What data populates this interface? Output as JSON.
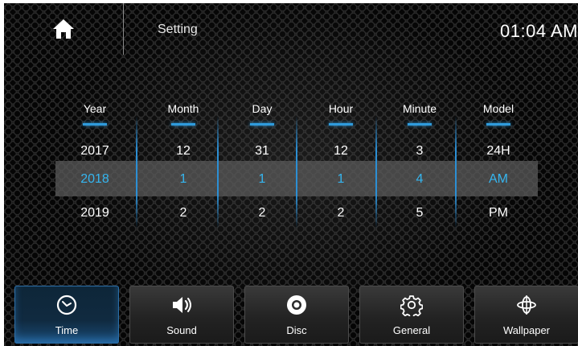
{
  "header": {
    "title": "Setting",
    "clock": "01:04 AM"
  },
  "picker": {
    "columns": [
      {
        "header": "Year",
        "values": [
          "2017",
          "2018",
          "2019"
        ]
      },
      {
        "header": "Month",
        "values": [
          "12",
          "1",
          "2"
        ]
      },
      {
        "header": "Day",
        "values": [
          "31",
          "1",
          "2"
        ]
      },
      {
        "header": "Hour",
        "values": [
          "12",
          "1",
          "2"
        ]
      },
      {
        "header": "Minute",
        "values": [
          "3",
          "4",
          "5"
        ]
      },
      {
        "header": "Model",
        "values": [
          "24H",
          "AM",
          "PM"
        ]
      }
    ],
    "selected_row": 1
  },
  "nav": {
    "tabs": [
      {
        "label": "Time",
        "icon": "clock-icon",
        "active": true
      },
      {
        "label": "Sound",
        "icon": "speaker-icon",
        "active": false
      },
      {
        "label": "Disc",
        "icon": "disc-icon",
        "active": false
      },
      {
        "label": "General",
        "icon": "gear-icon",
        "active": false
      },
      {
        "label": "Wallpaper",
        "icon": "wallpaper-icon",
        "active": false
      }
    ]
  },
  "colors": {
    "accent": "#2f9bdc",
    "selected_text": "#35b6f0",
    "active_tab": "#1a4c78"
  }
}
